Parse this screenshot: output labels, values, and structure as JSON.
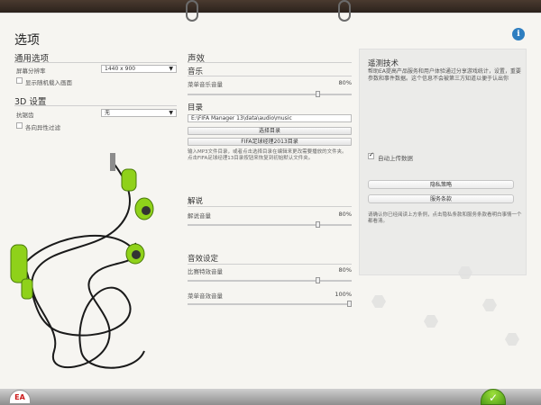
{
  "page": {
    "title": "选项",
    "brand": "EA"
  },
  "general": {
    "heading": "通用选项",
    "resolution_label": "屏幕分辨率",
    "resolution_value": "1440 x 900",
    "show_random_label": "显示随机载入画面"
  },
  "settings3d": {
    "heading": "3D 设置",
    "antialias_label": "抗锯齿",
    "antialias_value": "无",
    "aniso_label": "各向异性过滤"
  },
  "sound": {
    "heading": "声效",
    "music_heading": "音乐",
    "menu_music_label": "菜单音乐音量",
    "menu_music_value": "80%",
    "menu_music_level": 0.8,
    "directory_heading": "目录",
    "directory_path": "E:\\FIFA Manager 13\\data\\audio\\music",
    "choose_dir_button": "选择目录",
    "fifa_dir_button": "FIFA足球经理2013目录",
    "directory_note": "输入MP3文件目录，或者点击选择目录在编辑来更改需要播放的文件夹。点击FIFA足球经理13目录按钮来恢复到初始默认文件夹。"
  },
  "commentary": {
    "heading": "解说",
    "volume_label": "解说音量",
    "volume_value": "80%",
    "volume_level": 0.8
  },
  "sfx": {
    "heading": "音效设定",
    "match_label": "比赛特效音量",
    "match_value": "80%",
    "match_level": 0.8,
    "menu_label": "菜单音效音量",
    "menu_value": "100%",
    "menu_level": 1.0
  },
  "telemetry": {
    "heading": "遥测技术",
    "description": "帮助EA提高产品服务和用户体验通过分享游戏统计，设置，重要参数和事件数据。这个信息不会被第三方知道以便于认出你",
    "auto_upload_label": "自动上传数据",
    "privacy_button": "隐私策略",
    "terms_button": "服务条款",
    "footnote": "请确认你已经阅读上方条例，点击隐私条款和服务条款看明白事情一个都看清。"
  },
  "footer": {
    "ok_icon": "check-icon"
  },
  "colors": {
    "info": "#2e7ec0",
    "ok": "#6cbf1f",
    "earphone": "#8fd11a"
  }
}
